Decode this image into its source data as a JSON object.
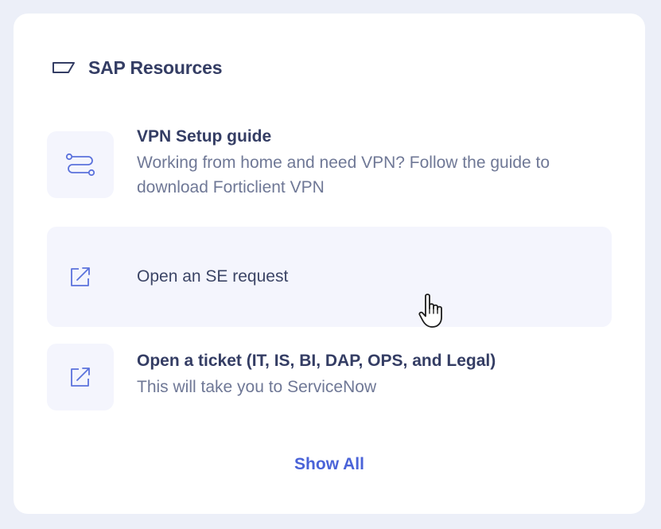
{
  "widget": {
    "title": "SAP Resources",
    "header_icon": "tag-icon",
    "show_all_label": "Show All",
    "accent_color": "#4a63d8"
  },
  "items": [
    {
      "icon": "route-icon",
      "title": "VPN Setup guide",
      "description": "Working from home and need VPN? Follow the guide to download Forticlient VPN"
    },
    {
      "icon": "external-link-icon",
      "title": "Open an SE request",
      "state": "hover"
    },
    {
      "icon": "external-link-icon",
      "title": "Open a ticket (IT, IS, BI, DAP, OPS, and Legal)",
      "description": "This will take you to ServiceNow"
    }
  ]
}
